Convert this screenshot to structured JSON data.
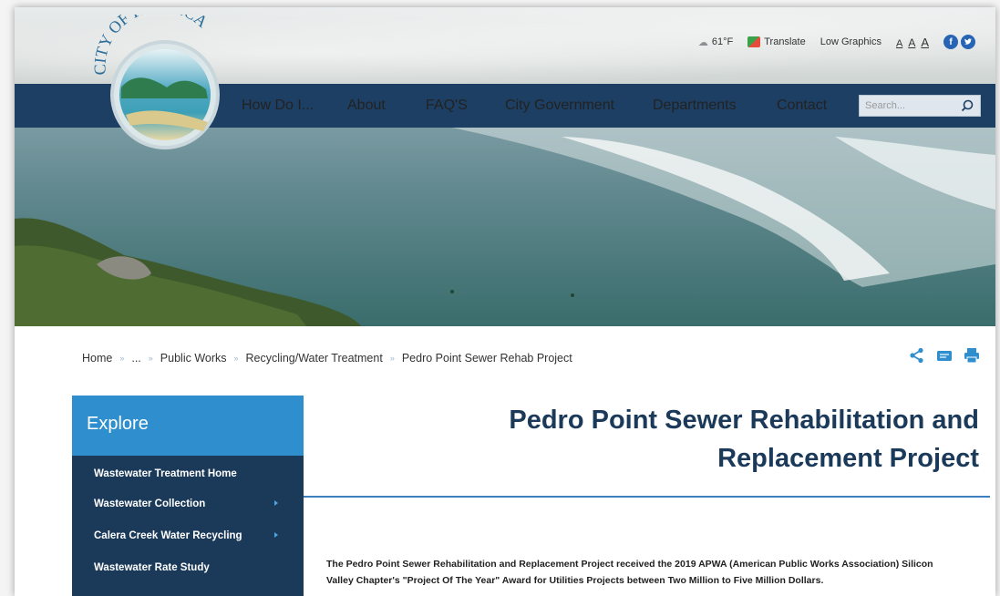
{
  "logo": {
    "text": "CITY OF PACIFICA"
  },
  "utility": {
    "weather": "61°F",
    "translate": "Translate",
    "low_graphics": "Low Graphics",
    "font_sizes": [
      "A",
      "A",
      "A"
    ],
    "social": [
      {
        "name": "facebook-icon",
        "glyph": "f"
      },
      {
        "name": "twitter-icon",
        "glyph": "t"
      }
    ]
  },
  "nav": {
    "items": [
      "How Do I...",
      "About",
      "FAQ'S",
      "City Government",
      "Departments",
      "Contact"
    ],
    "search_placeholder": "Search..."
  },
  "breadcrumb": [
    "Home",
    "...",
    "Public Works",
    "Recycling/Water Treatment",
    "Pedro Point Sewer Rehab Project"
  ],
  "sidebar": {
    "heading": "Explore",
    "items": [
      {
        "label": "Wastewater Treatment Home",
        "has_children": false
      },
      {
        "label": "Wastewater Collection",
        "has_children": true
      },
      {
        "label": "Calera Creek Water Recycling",
        "has_children": true
      },
      {
        "label": "Wastewater Rate Study",
        "has_children": false
      }
    ]
  },
  "main": {
    "title_line1": "Pedro Point Sewer Rehabilitation and",
    "title_line2": "Replacement Project",
    "intro_line1": "The Pedro Point Sewer Rehabilitation and Replacement Project received the 2019 APWA (American Public Works Association) Silicon",
    "intro_line2": "Valley Chapter's \"Project Of The Year\" Award for Utilities Projects between Two Million to Five Million Dollars."
  },
  "colors": {
    "nav_bg": "#1c3f63",
    "explore_bg": "#2f8fce",
    "sidenav_bg": "#1b3a5a",
    "title": "#1b3a5a",
    "rule": "#3d7ebf"
  }
}
